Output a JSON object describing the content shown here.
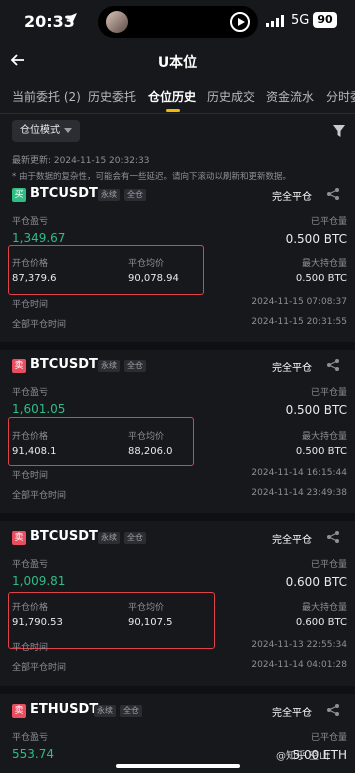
{
  "status_bar": {
    "time": "20:33",
    "network": "5G",
    "battery": "90"
  },
  "header": {
    "title": "U本位"
  },
  "tabs": [
    {
      "label": "当前委托 (2)"
    },
    {
      "label": "历史委托"
    },
    {
      "label": "仓位历史"
    },
    {
      "label": "历史成交"
    },
    {
      "label": "资金流水"
    },
    {
      "label": "分时委"
    }
  ],
  "filter": {
    "mode_label": "仓位模式"
  },
  "last_update": "最新更新: 2024-11-15 20:32:33",
  "note": "* 由于数据的复杂性，可能会有一些延迟。请向下滚动以刷新和更新数据。",
  "labels": {
    "close_pnl": "平仓盈亏",
    "closed_qty": "已平仓量",
    "open_price": "开仓价格",
    "close_avg": "平仓均价",
    "max_hold": "最大持仓量",
    "open_time": "平仓时间",
    "full_close_time": "全部平仓时间"
  },
  "positions": [
    {
      "side": "买",
      "symbol": "BTCUSDT",
      "type": "永续",
      "margin": "全仓",
      "status": "完全平仓",
      "pnl": "1,349.67",
      "closed_qty": "0.500 BTC",
      "open_price": "87,379.6",
      "close_avg": "90,078.94",
      "max_hold": "0.500 BTC",
      "close_time": "2024-11-15 07:08:37",
      "full_close_time": "2024-11-15 20:31:55"
    },
    {
      "side": "卖",
      "symbol": "BTCUSDT",
      "type": "永续",
      "margin": "全仓",
      "status": "完全平仓",
      "pnl": "1,601.05",
      "closed_qty": "0.500 BTC",
      "open_price": "91,408.1",
      "close_avg": "88,206.0",
      "max_hold": "0.500 BTC",
      "close_time": "2024-11-14 16:15:44",
      "full_close_time": "2024-11-14 23:49:38"
    },
    {
      "side": "卖",
      "symbol": "BTCUSDT",
      "type": "永续",
      "margin": "全仓",
      "status": "完全平仓",
      "pnl": "1,009.81",
      "closed_qty": "0.600 BTC",
      "open_price": "91,790.53",
      "close_avg": "90,107.5",
      "max_hold": "0.600 BTC",
      "close_time": "2024-11-13 22:55:34",
      "full_close_time": "2024-11-14 04:01:28"
    },
    {
      "side": "卖",
      "symbol": "ETHUSDT",
      "type": "永续",
      "margin": "全仓",
      "status": "完全平仓",
      "pnl": "553.74",
      "closed_qty": "5.00 ETH"
    }
  ],
  "watermark": "@知乎 空山"
}
